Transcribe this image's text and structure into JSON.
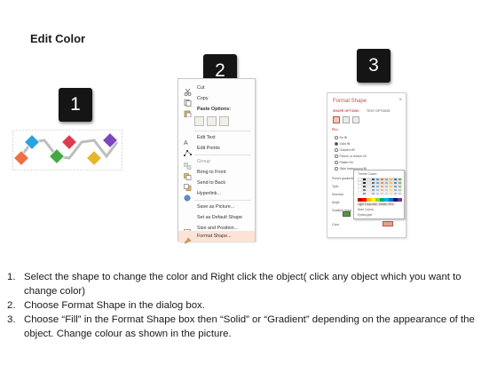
{
  "title": "Edit Color",
  "steps": [
    "1",
    "2",
    "3"
  ],
  "shape_colors": [
    "#ef6f45",
    "#2aa4dc",
    "#46a843",
    "#e03a4e",
    "#e8b62a",
    "#7d46c2"
  ],
  "context_menu": {
    "items": [
      {
        "label": "Cut",
        "icon": "scissors-icon",
        "disabled": false
      },
      {
        "label": "Copy",
        "icon": "copy-icon",
        "disabled": false
      },
      {
        "label": "Paste Options:",
        "icon": "paste-icon",
        "disabled": false
      },
      {
        "label": "Edit Text",
        "icon": "text-edit-icon",
        "disabled": false
      },
      {
        "label": "Edit Points",
        "icon": "edit-points-icon",
        "disabled": false
      },
      {
        "label": "Group",
        "icon": "group-icon",
        "disabled": true
      },
      {
        "label": "Bring to Front",
        "icon": "bring-front-icon",
        "disabled": false
      },
      {
        "label": "Send to Back",
        "icon": "send-back-icon",
        "disabled": false
      },
      {
        "label": "Hyperlink...",
        "icon": "hyperlink-icon",
        "disabled": false
      },
      {
        "label": "Save as Picture...",
        "icon": "",
        "disabled": false
      },
      {
        "label": "Set as Default Shape",
        "icon": "",
        "disabled": false
      },
      {
        "label": "Size and Position...",
        "icon": "size-position-icon",
        "disabled": false
      },
      {
        "label": "Format Shape...",
        "icon": "format-shape-icon",
        "disabled": false,
        "highlighted": true
      }
    ]
  },
  "format_pane": {
    "title": "Format Shape",
    "close": "×",
    "tabs": [
      "SHAPE OPTIONS",
      "TEXT OPTIONS"
    ],
    "section": "FILL",
    "fill_options": [
      "No fill",
      "Solid fill",
      "Gradient fill",
      "Picture or texture fill",
      "Pattern fill",
      "Slide background fill"
    ],
    "selected_fill": 1,
    "labels": [
      "Preset gradients",
      "Type",
      "Direction",
      "Angle",
      "Gradient stops",
      "Color"
    ],
    "palette": {
      "title": "Theme Colors",
      "items": [
        "Light Turquoise, Darker 25%",
        "More Colors...",
        "Eyedropper"
      ]
    }
  },
  "instructions": [
    {
      "num": "1.",
      "text": "Select the shape to change the color and Right click the object( click any object which you want to change color)"
    },
    {
      "num": "2.",
      "text": "Choose Format Shape in the dialog box."
    },
    {
      "num": "3.",
      "text": "Choose “Fill” in the Format Shape box then “Solid” or “Gradient” depending on the appearance of the object. Change colour as shown in the picture."
    }
  ]
}
